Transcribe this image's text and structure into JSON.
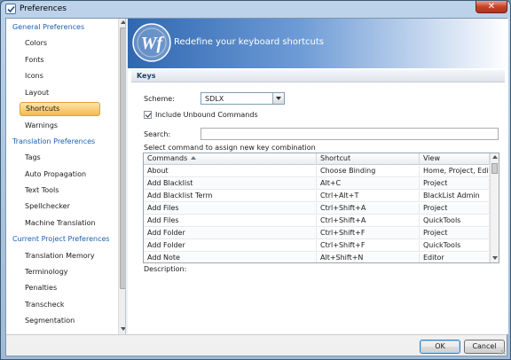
{
  "window": {
    "title": "Preferences",
    "close_glyph": "✕"
  },
  "nav": {
    "groups": [
      {
        "label": "General Preferences",
        "items": [
          "Colors",
          "Fonts",
          "Icons",
          "Layout",
          "Shortcuts",
          "Warnings"
        ]
      },
      {
        "label": "Translation Preferences",
        "items": [
          "Tags",
          "Auto Propagation",
          "Text Tools",
          "Spellchecker",
          "Machine Translation"
        ]
      },
      {
        "label": "Current Project Preferences",
        "items": [
          "Translation Memory",
          "Terminology",
          "Penalties",
          "Transcheck",
          "Segmentation"
        ]
      }
    ],
    "selected": "Shortcuts"
  },
  "banner": {
    "logo_text": "Wf",
    "heading": "Redefine your keyboard shortcuts"
  },
  "keys": {
    "section_title": "Keys",
    "scheme_label": "Scheme:",
    "scheme_value": "SDLX",
    "include_unbound_label": "Include Unbound Commands",
    "include_unbound_checked": true,
    "search_label": "Search:",
    "search_value": "",
    "select_command_label": "Select command to assign new key combination",
    "description_label": "Description:"
  },
  "table": {
    "headers": {
      "command": "Commands",
      "shortcut": "Shortcut",
      "view": "View"
    },
    "rows": [
      {
        "command": "About",
        "shortcut": "Choose Binding",
        "view": "Home, Project, Edit..."
      },
      {
        "command": "Add Blacklist",
        "shortcut": "Alt+C",
        "view": "Project"
      },
      {
        "command": "Add Blacklist Term",
        "shortcut": "Ctrl+Alt+T",
        "view": "BlackList Admin"
      },
      {
        "command": "Add Files",
        "shortcut": "Ctrl+Shift+A",
        "view": "Project"
      },
      {
        "command": "Add Files",
        "shortcut": "Ctrl+Shift+A",
        "view": "QuickTools"
      },
      {
        "command": "Add Folder",
        "shortcut": "Ctrl+Shift+F",
        "view": "Project"
      },
      {
        "command": "Add Folder",
        "shortcut": "Ctrl+Shift+F",
        "view": "QuickTools"
      },
      {
        "command": "Add Note",
        "shortcut": "Alt+Shift+N",
        "view": "Editor"
      }
    ]
  },
  "footer": {
    "ok_label": "OK",
    "cancel_label": "Cancel"
  },
  "colors": {
    "accent": "#1a5fb4",
    "selected_bg": "#f5b84e",
    "banner_blue": "#2f67b1"
  }
}
